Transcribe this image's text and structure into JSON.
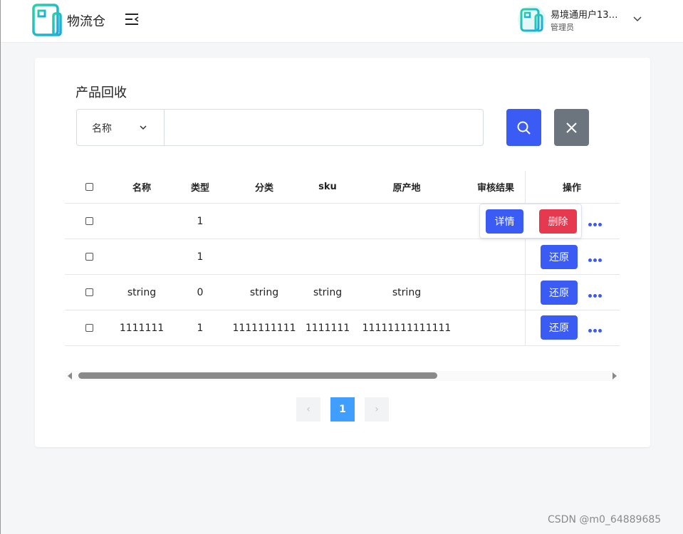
{
  "header": {
    "app_name": "物流仓",
    "user_name": "易境通用户133...",
    "user_role": "管理员"
  },
  "page": {
    "title": "产品回收"
  },
  "search": {
    "field_label": "名称",
    "input_value": "",
    "placeholder": ""
  },
  "table": {
    "columns": [
      "名称",
      "类型",
      "分类",
      "sku",
      "原产地",
      "审核结果",
      "操作"
    ],
    "rows": [
      {
        "name": "",
        "type": "1",
        "category": "",
        "sku": "",
        "origin": "",
        "review": ""
      },
      {
        "name": "",
        "type": "1",
        "category": "",
        "sku": "",
        "origin": "",
        "review": ""
      },
      {
        "name": "string",
        "type": "0",
        "category": "string",
        "sku": "string",
        "origin": "string",
        "review": ""
      },
      {
        "name": "1111111",
        "type": "1",
        "category": "1111111111",
        "sku": "1111111",
        "origin": "11111111111111",
        "review": ""
      }
    ],
    "restore_label": "还原",
    "detail_label": "详情",
    "delete_label": "删除"
  },
  "pagination": {
    "current_page": "1",
    "prev_symbol": "‹",
    "next_symbol": "›"
  },
  "watermark": "CSDN @m0_64889685",
  "colors": {
    "primary": "#3b5bf5",
    "danger": "#e63950",
    "secondary": "#6c757d",
    "page_active": "#409eff",
    "logo": "#1fbfd0"
  }
}
